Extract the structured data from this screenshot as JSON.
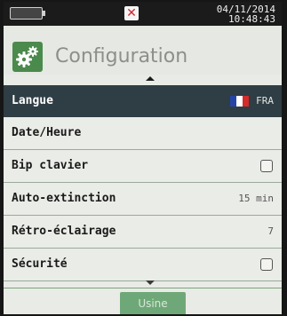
{
  "status": {
    "battery_level": 0,
    "battery_icon": "battery-icon",
    "close_icon": "close-icon",
    "date": "04/11/2014",
    "time": "10:48:43"
  },
  "header": {
    "icon": "gears-icon",
    "title": "Configuration"
  },
  "menu": [
    {
      "label": "Langue",
      "value": "FRA",
      "flag_colors": [
        "#2346a6",
        "#ffffff",
        "#d52b2b"
      ]
    },
    {
      "label": "Date/Heure",
      "value": ""
    },
    {
      "label": "Bip clavier",
      "checked": false
    },
    {
      "label": "Auto-extinction",
      "value": "15 min"
    },
    {
      "label": "Rétro-éclairage",
      "value": "7"
    },
    {
      "label": "Sécurité",
      "checked": false
    }
  ],
  "footer": {
    "usine_label": "Usine"
  },
  "colors": {
    "accent": "#4a8a4c",
    "selected_row": "#2f3d44",
    "button": "#6fa878"
  }
}
